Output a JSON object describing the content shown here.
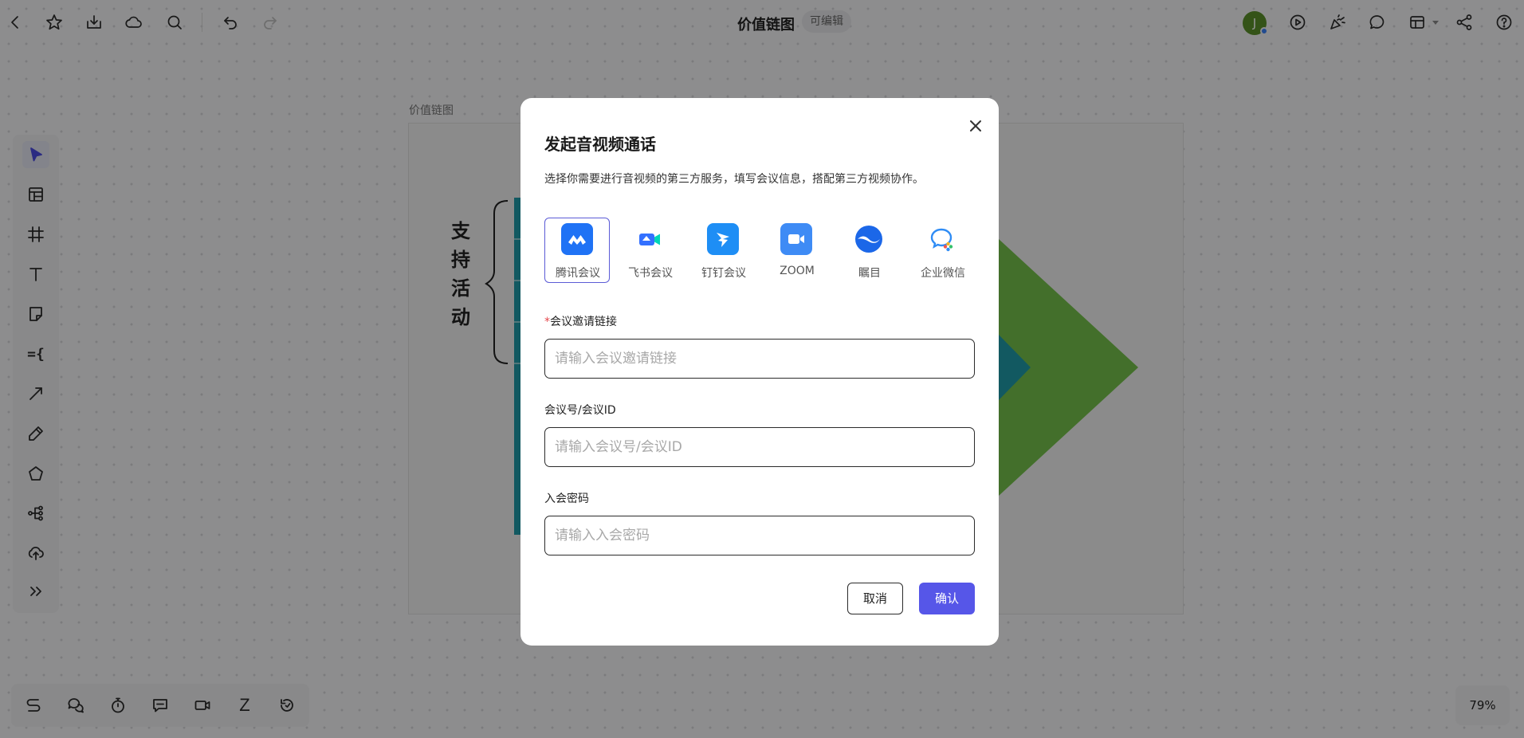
{
  "app": {
    "doc_title": "价值链图",
    "edit_status": "可编辑",
    "avatar_initial": "J",
    "zoom": "79%"
  },
  "canvas": {
    "frame_label": "价值链图",
    "support_activities": "支持活动",
    "colors": {
      "teal": "#1f9aa8",
      "green": "#74c04a"
    }
  },
  "toolbar": {
    "left_icons": [
      "select-arrow-icon",
      "template-icon",
      "frame-icon",
      "text-icon",
      "sticky-note-icon",
      "formula-icon",
      "connector-line-icon",
      "pen-icon",
      "shape-icon",
      "mindmap-icon",
      "upload-icon",
      "more-icon"
    ],
    "formula_glyph": "={",
    "z_glyph": "Z"
  },
  "modal": {
    "title": "发起音视频通话",
    "description": "选择你需要进行音视频的第三方服务，填写会议信息，搭配第三方视频协作。",
    "providers": [
      {
        "label": "腾讯会议",
        "selected": true
      },
      {
        "label": "飞书会议",
        "selected": false
      },
      {
        "label": "钉钉会议",
        "selected": false
      },
      {
        "label": "ZOOM",
        "selected": false
      },
      {
        "label": "瞩目",
        "selected": false
      },
      {
        "label": "企业微信",
        "selected": false
      }
    ],
    "fields": {
      "invite_link": {
        "required_mark": "*",
        "label": "会议邀请链接",
        "placeholder": "请输入会议邀请链接",
        "value": ""
      },
      "meeting_id": {
        "label": "会议号/会议ID",
        "placeholder": "请输入会议号/会议ID",
        "value": ""
      },
      "password": {
        "label": "入会密码",
        "placeholder": "请输入入会密码",
        "value": ""
      }
    },
    "cancel_label": "取消",
    "confirm_label": "确认",
    "accent_color": "#5656e8"
  }
}
